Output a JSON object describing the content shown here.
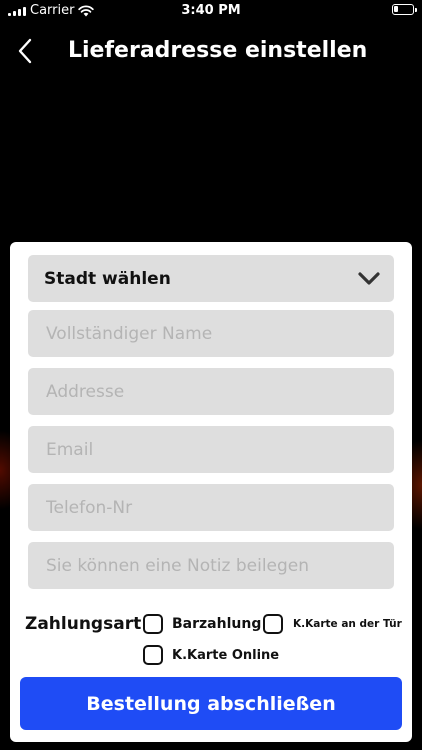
{
  "status_bar": {
    "carrier": "Carrier",
    "time": "3:40 PM"
  },
  "nav": {
    "title": "Lieferadresse einstellen",
    "back_icon": "chevron-left-icon"
  },
  "form": {
    "city_select": {
      "selected": "Stadt wählen",
      "icon": "chevron-down-icon"
    },
    "name_placeholder": "Vollständiger Name",
    "address_placeholder": "Addresse",
    "email_placeholder": "Email",
    "phone_placeholder": "Telefon-Nr",
    "note_placeholder": "Sie können eine Notiz beilegen"
  },
  "payment": {
    "label": "Zahlungsart:",
    "options": [
      {
        "label": "Barzahlung",
        "checked": false
      },
      {
        "label": "K.Karte an der Tür",
        "checked": false
      },
      {
        "label": "K.Karte Online",
        "checked": false
      }
    ]
  },
  "submit_label": "Bestellung abschließen",
  "colors": {
    "accent": "#1f4cf5",
    "field_bg": "#dedede",
    "background": "#000000"
  }
}
